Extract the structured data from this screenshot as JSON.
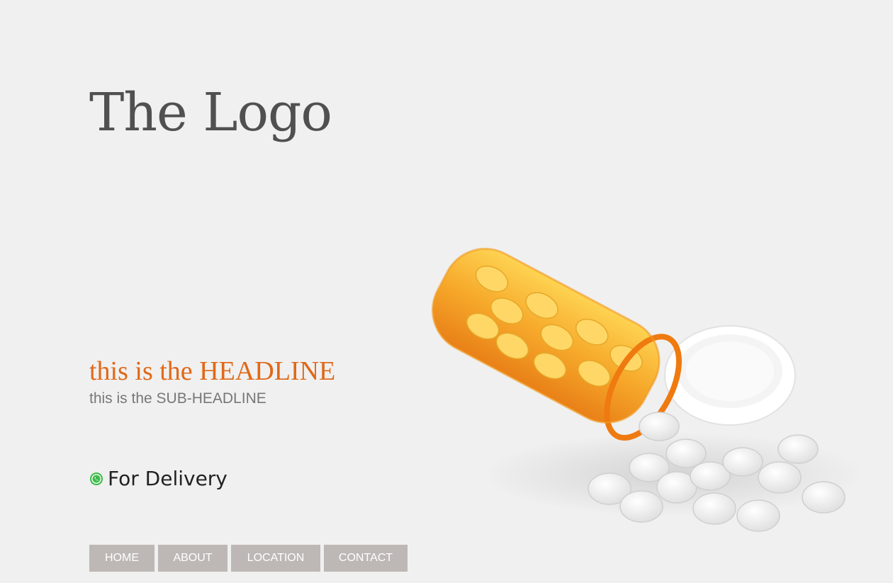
{
  "logo": {
    "text": "The Logo"
  },
  "hero": {
    "headline": "this is the HEADLINE",
    "subheadline": "this is the SUB-HEADLINE",
    "delivery_label": "For Delivery",
    "delivery_icon": "whatsapp-icon",
    "image": "pill-bottle-spilled-pills"
  },
  "nav": {
    "items": [
      {
        "label": "HOME"
      },
      {
        "label": "ABOUT"
      },
      {
        "label": "LOCATION"
      },
      {
        "label": "CONTACT"
      }
    ]
  },
  "colors": {
    "background": "#f0f0f0",
    "headline": "#e06818",
    "logo": "#505050",
    "nav_button": "#bdb8b5",
    "whatsapp": "#3fba4b"
  }
}
